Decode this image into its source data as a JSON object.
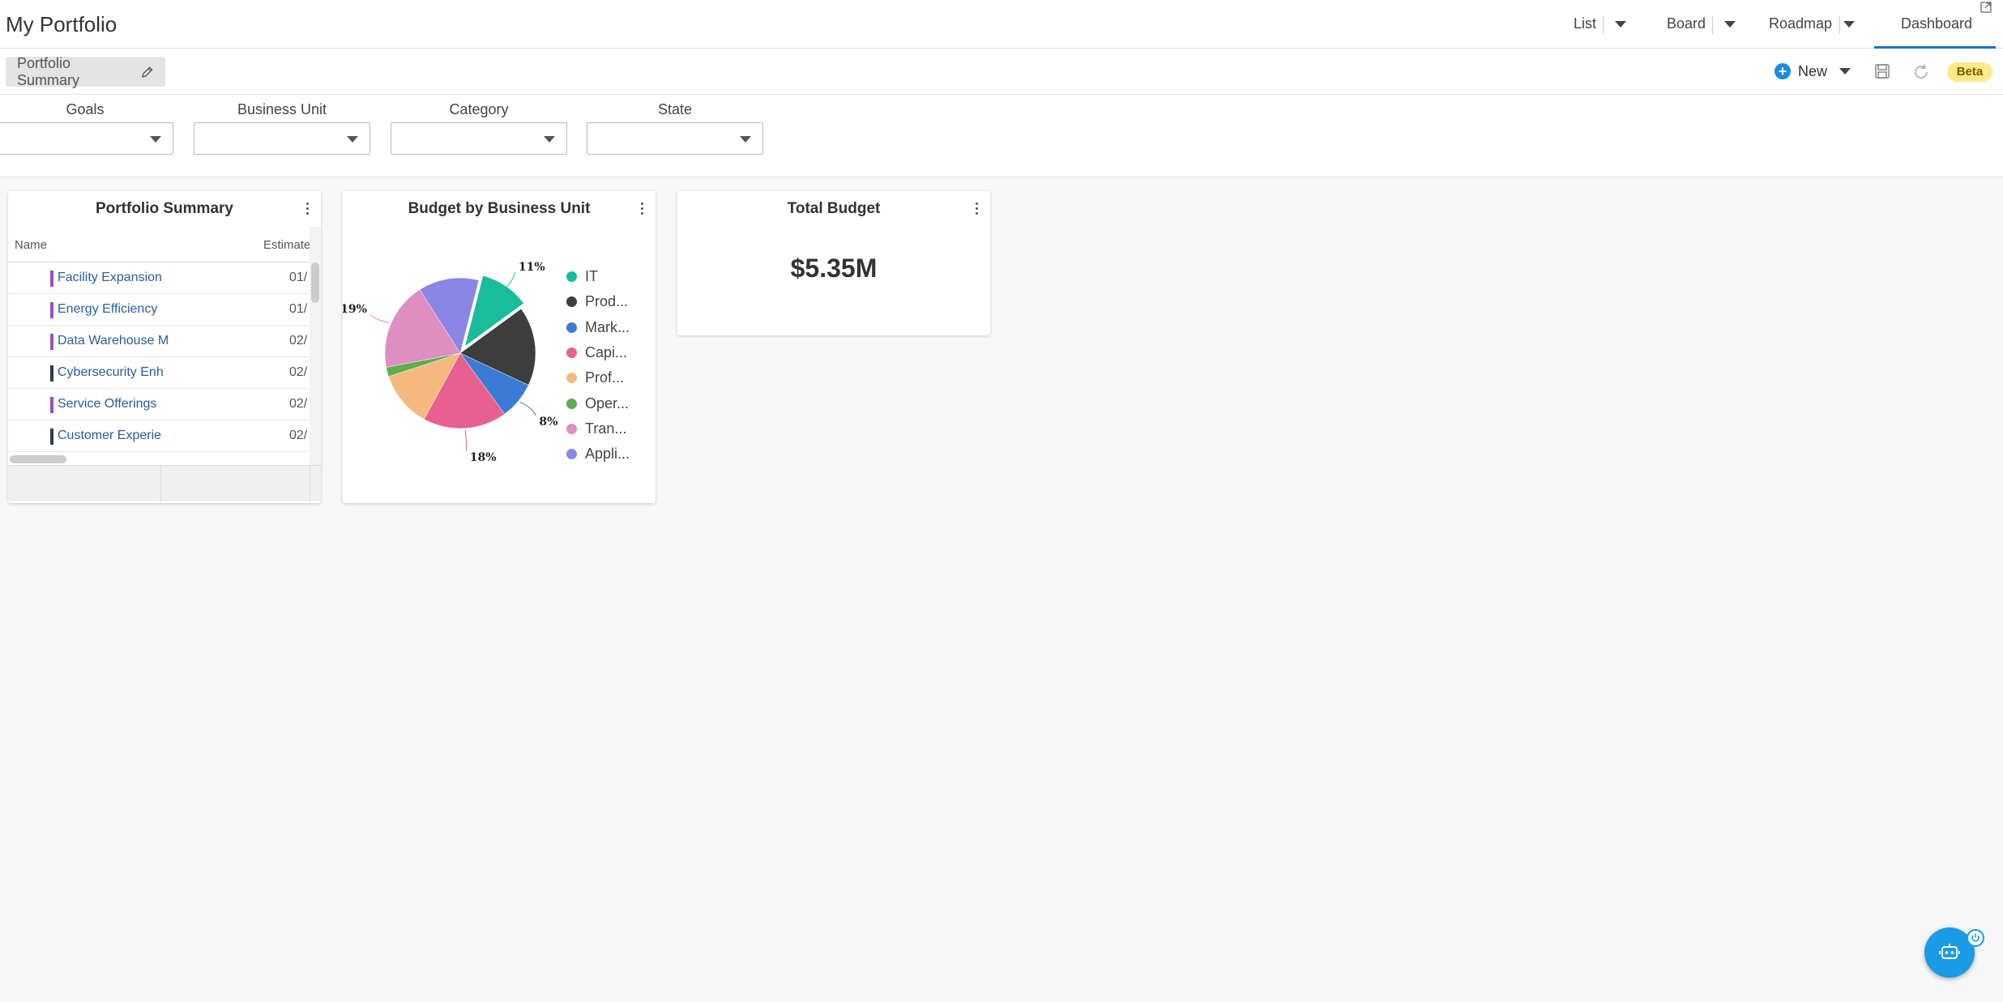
{
  "app": {
    "title": "My Portfolio"
  },
  "nav": {
    "list": "List",
    "board": "Board",
    "roadmap": "Roadmap",
    "dashboard": "Dashboard"
  },
  "toolbar": {
    "view_name": "Portfolio Summary",
    "new_label": "New",
    "beta": "Beta"
  },
  "filters": [
    {
      "label": "Goals",
      "value": ""
    },
    {
      "label": "Business Unit",
      "value": ""
    },
    {
      "label": "Category",
      "value": ""
    },
    {
      "label": "State",
      "value": ""
    }
  ],
  "portfolio_summary": {
    "title": "Portfolio Summary",
    "columns": [
      "Name",
      "Estimated"
    ],
    "rows": [
      {
        "name": "Facility Expansion",
        "date": "01/",
        "color": "#9b4fc0"
      },
      {
        "name": "Energy Efficiency",
        "date": "01/",
        "color": "#9b4fc0"
      },
      {
        "name": "Data Warehouse M",
        "date": "02/",
        "color": "#9b4fc0"
      },
      {
        "name": "Cybersecurity Enh",
        "date": "02/",
        "color": "#333a4d"
      },
      {
        "name": "Service Offerings",
        "date": "02/",
        "color": "#9b4fc0"
      },
      {
        "name": "Customer Experie",
        "date": "02/",
        "color": "#333a4d"
      }
    ]
  },
  "budget_chart": {
    "title": "Budget by Business Unit",
    "legend": [
      "IT",
      "Prod...",
      "Mark...",
      "Capi...",
      "Prof...",
      "Oper...",
      "Tran...",
      "Appli..."
    ]
  },
  "chart_data": {
    "type": "pie",
    "title": "Budget by Business Unit",
    "categories": [
      "IT",
      "Prod...",
      "Mark...",
      "Capi...",
      "Prof...",
      "Oper...",
      "Tran...",
      "Appli..."
    ],
    "values": [
      11,
      17,
      8,
      18,
      12,
      2,
      19,
      13
    ],
    "data_labels": [
      "11%",
      "",
      "8%",
      "18%",
      "",
      "",
      "19%",
      ""
    ],
    "colors": [
      "#1abc9c",
      "#3d3d3d",
      "#3a7bd5",
      "#e8608f",
      "#f5b97f",
      "#5fad4e",
      "#de8ec0",
      "#8a86e6"
    ],
    "legend_position": "right"
  },
  "total_budget": {
    "title": "Total Budget",
    "value": "$5.35M"
  }
}
